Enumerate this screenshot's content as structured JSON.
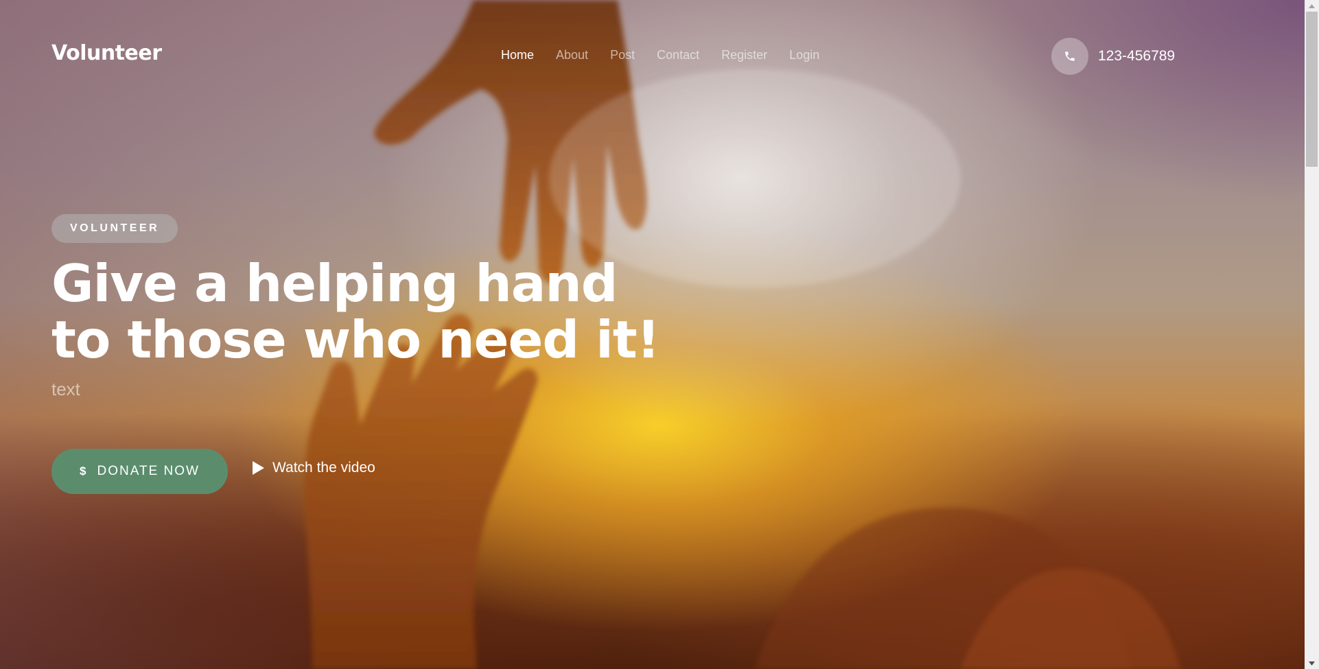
{
  "brand": {
    "logo_text": "Volunteer"
  },
  "nav": {
    "items": [
      {
        "label": "Home",
        "active": true
      },
      {
        "label": "About",
        "active": false
      },
      {
        "label": "Post",
        "active": false
      },
      {
        "label": "Contact",
        "active": false
      },
      {
        "label": "Register",
        "active": false
      },
      {
        "label": "Login",
        "active": false
      }
    ]
  },
  "contact": {
    "phone_icon": "phone-icon",
    "phone_number": "123-456789"
  },
  "hero": {
    "badge": "VOLUNTEER",
    "headline_line1": "Give a helping hand",
    "headline_line2": "to those who need it!",
    "subtext": "text",
    "donate_icon": "$",
    "donate_label": "DONATE NOW",
    "watch_label": "Watch the video"
  },
  "colors": {
    "accent": "#5b8d6d",
    "text": "#ffffff"
  }
}
